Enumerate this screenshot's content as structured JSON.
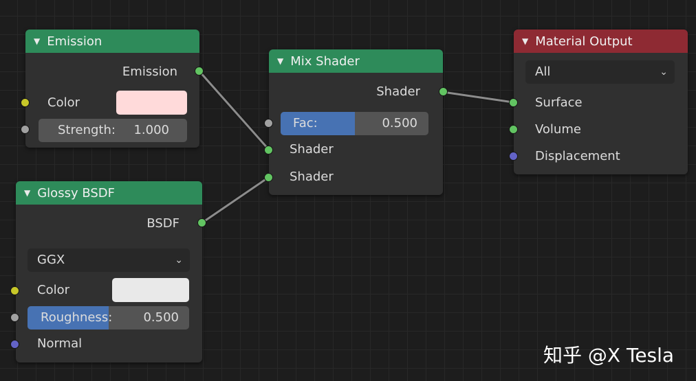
{
  "nodes": {
    "emission": {
      "title": "Emission",
      "output_label": "Emission",
      "color_label": "Color",
      "color_value": "#ffdada",
      "strength_label": "Strength:",
      "strength_value": "1.000"
    },
    "glossy": {
      "title": "Glossy BSDF",
      "output_label": "BSDF",
      "distribution": "GGX",
      "color_label": "Color",
      "color_value": "#e9e9e9",
      "roughness_label": "Roughness:",
      "roughness_value": "0.500",
      "roughness_fraction": 0.5,
      "normal_label": "Normal"
    },
    "mix": {
      "title": "Mix Shader",
      "output_label": "Shader",
      "fac_label": "Fac:",
      "fac_value": "0.500",
      "fac_fraction": 0.5,
      "input1_label": "Shader",
      "input2_label": "Shader"
    },
    "output": {
      "title": "Material Output",
      "target": "All",
      "surface_label": "Surface",
      "volume_label": "Volume",
      "displacement_label": "Displacement"
    }
  },
  "icons": {
    "collapse": "triangle-down-icon",
    "dropdown": "chevron-down-icon"
  },
  "colors": {
    "shader_header": "#2e8b5a",
    "output_header": "#8e2a33",
    "shader_socket": "#62c462",
    "color_socket": "#c7c729",
    "float_socket": "#a1a1a1",
    "vector_socket": "#6363c7",
    "slider_fill": "#4772b3"
  },
  "watermark": "知乎 @X Tesla"
}
